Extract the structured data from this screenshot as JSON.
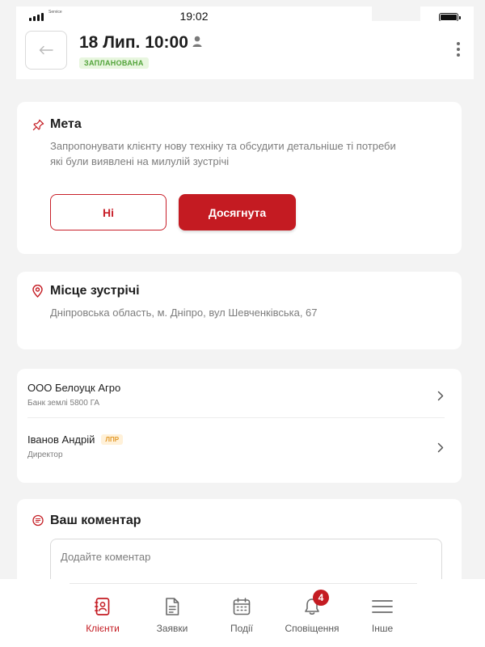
{
  "status_bar": {
    "carrier": "Service",
    "time": "19:02"
  },
  "header": {
    "back_icon": "arrow-left-icon",
    "title": "18 Лип. 10:00",
    "status": "ЗАПЛАНОВАНА"
  },
  "goal": {
    "title": "Мета",
    "text": "Запропонувати клієнту нову техніку та обсудити детальніше ті потреби які були виявлені на милулій зустрічі",
    "no_label": "Ні",
    "yes_label": "Досягнута"
  },
  "place": {
    "title": "Місце зустрічі",
    "address": "Дніпровська область, м. Дніпро, вул Шевченківська, 67"
  },
  "contacts": [
    {
      "name": "ООО Белоуцк Агро",
      "sub": "Банк землі  5800 ГА",
      "badge": ""
    },
    {
      "name": "Іванов Андрій",
      "sub": "Директор",
      "badge": "ЛПР"
    }
  ],
  "comment": {
    "title": "Ваш коментар",
    "placeholder": "Додайте коментар"
  },
  "nav": {
    "items": [
      {
        "label": "Клієнти",
        "icon": "contacts-book-icon",
        "active": true
      },
      {
        "label": "Заявки",
        "icon": "document-icon",
        "active": false
      },
      {
        "label": "Події",
        "icon": "calendar-icon",
        "active": false
      },
      {
        "label": "Сповіщення",
        "icon": "bell-icon",
        "active": false,
        "badge": "4"
      },
      {
        "label": "Інше",
        "icon": "menu-icon",
        "active": false
      }
    ]
  },
  "colors": {
    "accent": "#c41b22",
    "status_green": "#52a43a",
    "badge_orange": "#e39a2a"
  }
}
